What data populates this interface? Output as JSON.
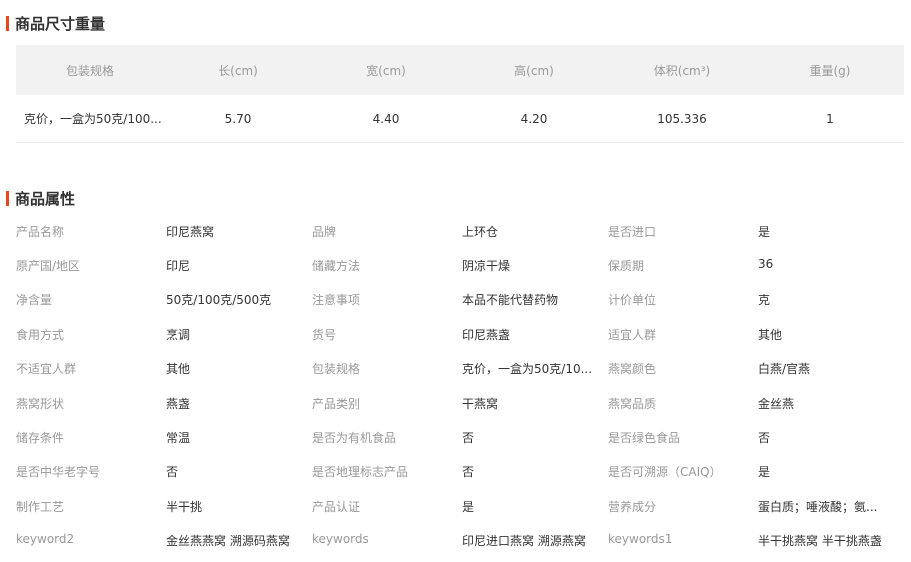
{
  "size_section": {
    "title": "商品尺寸重量",
    "headers": [
      "包装规格",
      "长(cm)",
      "宽(cm)",
      "高(cm)",
      "体积(cm³)",
      "重量(g)"
    ],
    "row": [
      "克价，一盒为50克/100...",
      "5.70",
      "4.40",
      "4.20",
      "105.336",
      "1"
    ]
  },
  "attr_section": {
    "title": "商品属性",
    "rows": [
      [
        {
          "label": "产品名称",
          "value": "印尼燕窝"
        },
        {
          "label": "品牌",
          "value": "上环仓"
        },
        {
          "label": "是否进口",
          "value": "是"
        }
      ],
      [
        {
          "label": "原产国/地区",
          "value": "印尼"
        },
        {
          "label": "储藏方法",
          "value": "阴凉干燥"
        },
        {
          "label": "保质期",
          "value": "36"
        }
      ],
      [
        {
          "label": "净含量",
          "value": "50克/100克/500克"
        },
        {
          "label": "注意事项",
          "value": "本品不能代替药物"
        },
        {
          "label": "计价单位",
          "value": "克"
        }
      ],
      [
        {
          "label": "食用方式",
          "value": "烹调"
        },
        {
          "label": "货号",
          "value": "印尼燕盏"
        },
        {
          "label": "适宜人群",
          "value": "其他"
        }
      ],
      [
        {
          "label": "不适宜人群",
          "value": "其他"
        },
        {
          "label": "包装规格",
          "value": "克价，一盒为50克/10..."
        },
        {
          "label": "燕窝颜色",
          "value": "白燕/官燕"
        }
      ],
      [
        {
          "label": "燕窝形状",
          "value": "燕盏"
        },
        {
          "label": "产品类别",
          "value": "干燕窝"
        },
        {
          "label": "燕窝品质",
          "value": "金丝燕"
        }
      ],
      [
        {
          "label": "储存条件",
          "value": "常温"
        },
        {
          "label": "是否为有机食品",
          "value": "否"
        },
        {
          "label": "是否绿色食品",
          "value": "否"
        }
      ],
      [
        {
          "label": "是否中华老字号",
          "value": "否"
        },
        {
          "label": "是否地理标志产品",
          "value": "否"
        },
        {
          "label": "是否可溯源（CAIQ）",
          "value": "是"
        }
      ],
      [
        {
          "label": "制作工艺",
          "value": "半干挑"
        },
        {
          "label": "产品认证",
          "value": "是"
        },
        {
          "label": "营养成分",
          "value": "蛋白质；唾液酸；氨..."
        }
      ],
      [
        {
          "label": "keyword2",
          "value": "金丝燕燕窝 溯源码燕窝"
        },
        {
          "label": "keywords",
          "value": "印尼进口燕窝 溯源燕窝"
        },
        {
          "label": "keywords1",
          "value": "半干挑燕窝 半干挑燕盏"
        }
      ]
    ]
  },
  "colors": {
    "accent": "#e8471c",
    "header_bg": "#f2f2f2",
    "label": "#999999",
    "value": "#333333"
  }
}
